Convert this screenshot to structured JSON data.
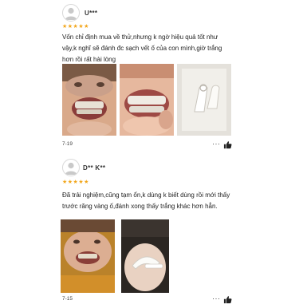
{
  "reviews": [
    {
      "username": "U***",
      "stars": "★★★★★",
      "lines": [
        "Vốn chỉ định mua về thử,nhưng k ngờ hiệu quả tốt như",
        "vậy,k nghĩ sẽ đánh đc sạch vết ố của con mình,giờ trắng",
        "hơn rồi rất hài lòng"
      ],
      "date": "7-19",
      "more": "···",
      "photos": [
        "child-smiling-teeth-photo",
        "child-teeth-closeup-photo",
        "white-strips-packet-photo"
      ]
    },
    {
      "username": "D** K**",
      "stars": "★★★★★",
      "lines": [
        "Đã trải nghiệm,cũng tạm ổn,k dùng k biết dùng rồi mới thấy",
        "trước răng vàng ố,đánh xong thấy trắng khác hơn hẳn."
      ],
      "date": "7-15",
      "more": "···",
      "photos": [
        "child-teeth-before-photo",
        "tooth-tray-on-hand-photo"
      ]
    }
  ],
  "colors": {
    "star": "#f2a61a",
    "text": "#222222",
    "meta": "#444444"
  },
  "icons": [
    "avatar-icon",
    "thumbs-up-icon",
    "more-dots-icon"
  ]
}
